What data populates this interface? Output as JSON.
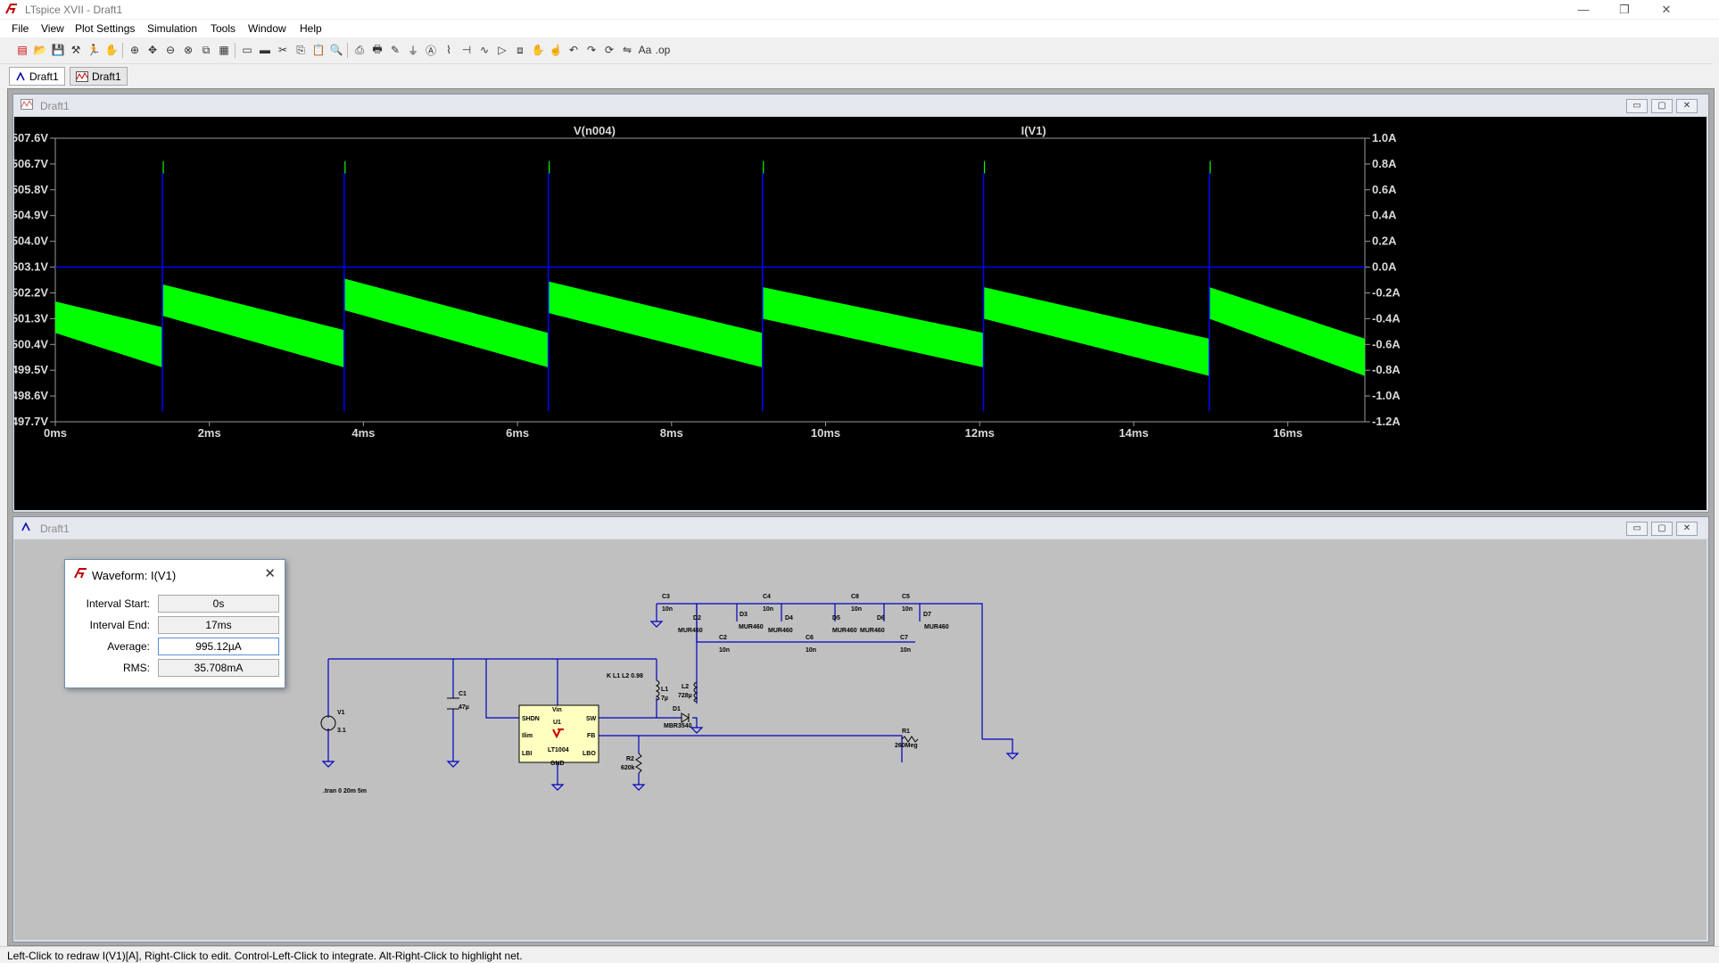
{
  "window": {
    "title": "LTspice XVII - Draft1",
    "minimize": "—",
    "restore": "❐",
    "close": "✕"
  },
  "menu": [
    {
      "label": "File"
    },
    {
      "label": "View"
    },
    {
      "label": "Plot Settings"
    },
    {
      "label": "Simulation"
    },
    {
      "label": "Tools"
    },
    {
      "label": "Window"
    },
    {
      "label": "Help"
    }
  ],
  "toolbar": [
    "new-schematic-icon",
    "open-icon",
    "save-icon",
    "control-panel-icon",
    "run-icon",
    "halt-icon",
    "zoom-in-icon",
    "zoom-pan-icon",
    "zoom-out-icon",
    "zoom-fit-icon",
    "autorange-icon",
    "grid-icon",
    "add-plot-pane-icon",
    "delete-plot-pane-icon",
    "cut-icon",
    "copy-icon",
    "paste-icon",
    "find-icon",
    "print-icon",
    "print-setup-icon",
    "wire-icon",
    "ground-icon",
    "label-icon",
    "resistor-icon",
    "capacitor-icon",
    "inductor-icon",
    "diode-icon",
    "component-icon",
    "move-icon",
    "drag-icon",
    "undo-icon",
    "redo-icon",
    "rotate-icon",
    "mirror-icon",
    "text-icon",
    "spice-directive-icon"
  ],
  "tabs": [
    {
      "label": "Draft1",
      "kind": "schematic"
    },
    {
      "label": "Draft1",
      "kind": "waveform"
    }
  ],
  "plot_window": {
    "title": "Draft1",
    "min": "▭",
    "max": "▢",
    "close": "✕"
  },
  "schematic_window": {
    "title": "Draft1",
    "min": "▭",
    "max": "▢",
    "close": "✕"
  },
  "chart_data": {
    "type": "line",
    "trace_labels": [
      "V(n004)",
      "I(V1)"
    ],
    "series": [
      {
        "name": "V(n004)",
        "color": "#00ff00",
        "axis": "left",
        "kind": "sawtooth band",
        "reset_times_ms": [
          1.39,
          3.75,
          6.4,
          9.18,
          12.05,
          14.98
        ],
        "band_top_at_start_V": [
          501.9,
          502.5,
          502.7,
          502.6,
          502.4,
          502.4
        ],
        "band_bottom_at_start_V": [
          500.8,
          501.4,
          501.6,
          501.5,
          501.3,
          501.3
        ],
        "band_top_at_end_V": [
          501.0,
          500.9,
          500.8,
          500.8,
          500.8,
          500.6
        ],
        "band_bottom_at_end_V": [
          499.6,
          499.6,
          499.6,
          499.6,
          499.6,
          499.3
        ],
        "spike_peak_V": 506.8
      },
      {
        "name": "I(V1)",
        "color": "#0000ff",
        "axis": "right",
        "kind": "baseline with spikes",
        "baseline_A": 0.0,
        "spike_times_ms": [
          1.39,
          3.75,
          6.4,
          9.18,
          12.05,
          14.98
        ],
        "spike_max_A": 0.73,
        "spike_min_A": -1.12
      }
    ],
    "x_range_ms": [
      0,
      17
    ],
    "x_ticks": [
      "0ms",
      "2ms",
      "4ms",
      "6ms",
      "8ms",
      "10ms",
      "12ms",
      "14ms",
      "16ms"
    ],
    "x_tick_values_ms": [
      0,
      2,
      4,
      6,
      8,
      10,
      12,
      14,
      16
    ],
    "y_left_ticks": [
      "507.6V",
      "506.7V",
      "505.8V",
      "504.9V",
      "504.0V",
      "503.1V",
      "502.2V",
      "501.3V",
      "500.4V",
      "499.5V",
      "498.6V",
      "497.7V"
    ],
    "y_left_range_V": [
      497.7,
      507.6
    ],
    "y_right_ticks": [
      "1.0A",
      "0.8A",
      "0.6A",
      "0.4A",
      "0.2A",
      "0.0A",
      "-0.2A",
      "-0.4A",
      "-0.6A",
      "-0.8A",
      "-1.0A",
      "-1.2A"
    ],
    "y_right_range_A": [
      -1.2,
      1.0
    ],
    "grid": false,
    "background": "#000000"
  },
  "dialog": {
    "title": "Waveform: I(V1)",
    "close": "✕",
    "rows": [
      {
        "label": "Interval Start:",
        "value": "0s"
      },
      {
        "label": "Interval End:",
        "value": "17ms"
      },
      {
        "label": "Average:",
        "value": "995.12µA"
      },
      {
        "label": "RMS:",
        "value": "35.708mA"
      }
    ]
  },
  "schematic": {
    "labels": {
      "v1": "V1",
      "v1val": "3.1",
      "c1": "C1",
      "c1val": "47µ",
      "u1vin": "Vin",
      "u1shdn": "SHDN",
      "u1": "U1",
      "u1ilim": "Ilim",
      "u1lbi": "LBI",
      "u1part": "LT1004",
      "u1gnd": "GND",
      "u1sw": "SW",
      "u1fb": "FB",
      "u1lbo": "LBO",
      "l1": "L1",
      "l1val": "7µ",
      "l2": "L2",
      "l2val": "728µ",
      "kstmt": "K L1 L2 0.98",
      "d1": "D1",
      "d1val": "MBR3540",
      "r1": "R1",
      "r1val": "260Meg",
      "r2": "R2",
      "r2val": "620k",
      "c3": "C3",
      "c3val": "10n",
      "c4": "C4",
      "c4val": "10n",
      "c8": "C8",
      "c8val": "10n",
      "c5": "C5",
      "c5val": "10n",
      "c2": "C2",
      "c2val": "10n",
      "c6": "C6",
      "c6val": "10n",
      "c7": "C7",
      "c7val": "10n",
      "d2": "D2",
      "d3": "D3",
      "d4": "D4",
      "d5": "D5",
      "d6": "D6",
      "d7": "D7",
      "dval": "MUR460",
      "tran": ".tran 0 20m 5m"
    }
  },
  "status": "Left-Click to redraw I(V1)[A],  Right-Click to edit. Control-Left-Click to integrate. Alt-Right-Click to highlight net."
}
